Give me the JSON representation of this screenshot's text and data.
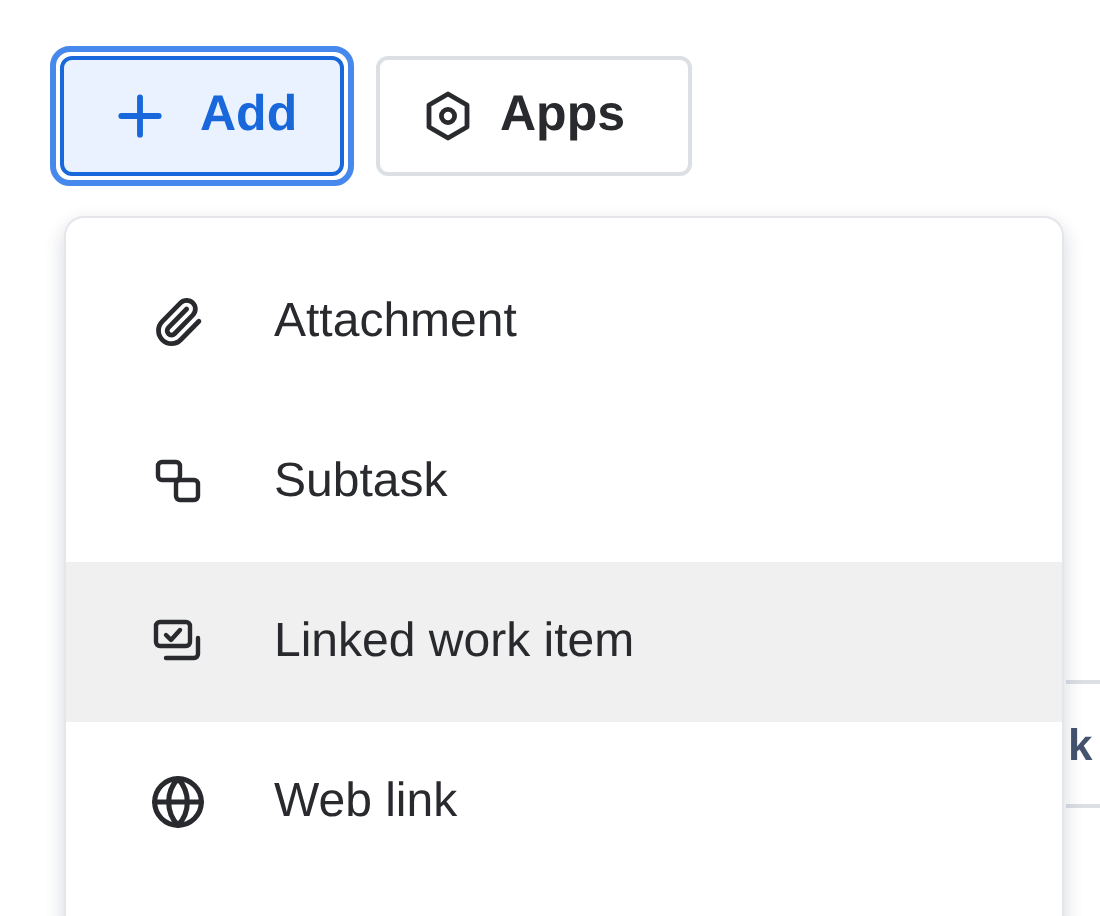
{
  "toolbar": [
    {
      "kind": "add",
      "label": "Add",
      "selected": true
    },
    {
      "kind": "apps",
      "label": "Apps",
      "selected": false
    }
  ],
  "menu": [
    {
      "kind": "attachment",
      "label": "Attachment",
      "selected": false
    },
    {
      "kind": "subtask",
      "label": "Subtask",
      "selected": false
    },
    {
      "kind": "linked",
      "label": "Linked work item",
      "selected": true
    },
    {
      "kind": "weblink",
      "label": "Web link",
      "selected": false
    }
  ],
  "background": {
    "column_1": "k"
  }
}
